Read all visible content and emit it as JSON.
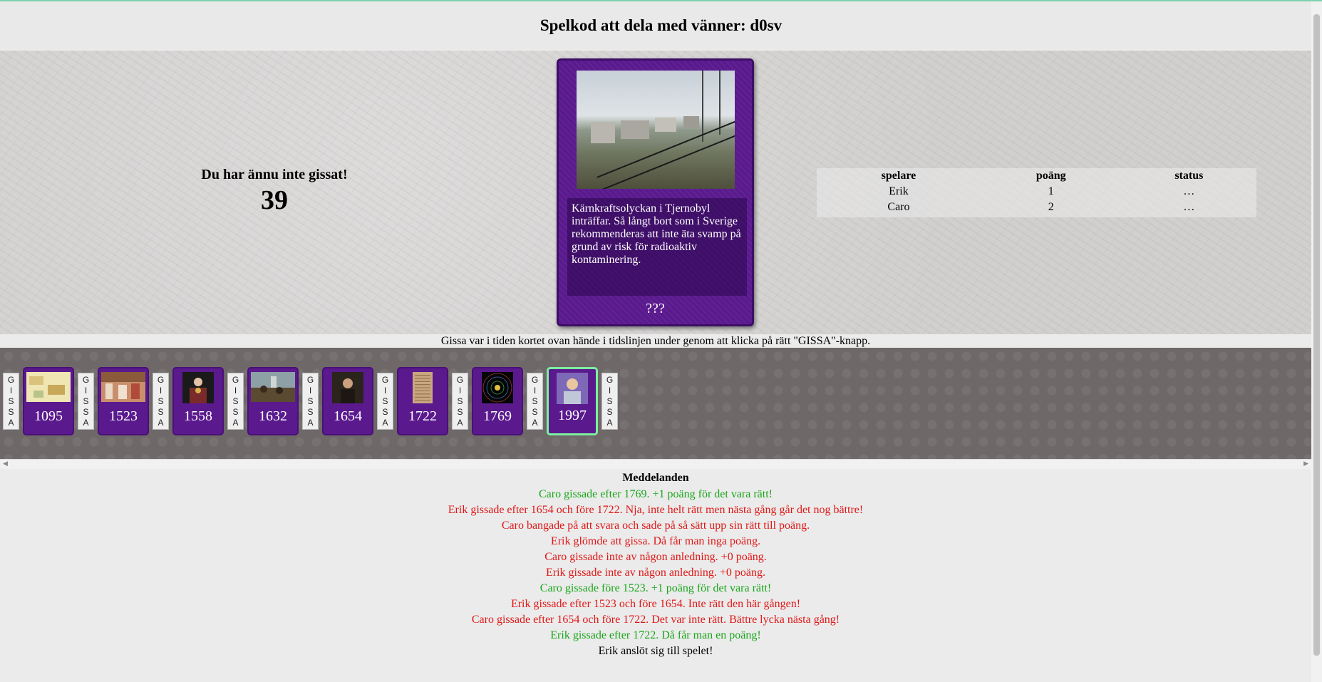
{
  "header": {
    "title": "Spelkod att dela med vänner: d0sv"
  },
  "guess_status": {
    "message": "Du har ännu inte gissat!",
    "countdown": "39"
  },
  "current_card": {
    "description": "Kärnkraftsolyckan i Tjernobyl inträffar. Så långt bort som i Sverige rekommenderas att inte äta svamp på grund av risk för radioaktiv kontaminering.",
    "year": "???"
  },
  "scoreboard": {
    "headers": [
      "spelare",
      "poäng",
      "status"
    ],
    "rows": [
      {
        "player": "Erik",
        "points": "1",
        "status": "…"
      },
      {
        "player": "Caro",
        "points": "2",
        "status": "…"
      }
    ]
  },
  "instruction": "Gissa var i tiden kortet ovan hände i tidslinjen under genom att klicka på rätt \"GISSA\"-knapp.",
  "guess_button_letters": [
    "G",
    "I",
    "S",
    "S",
    "A"
  ],
  "timeline": [
    {
      "year": "1095",
      "thumb": "map"
    },
    {
      "year": "1523",
      "thumb": "painting-crowd"
    },
    {
      "year": "1558",
      "thumb": "portrait-queen"
    },
    {
      "year": "1632",
      "thumb": "battle-painting"
    },
    {
      "year": "1654",
      "thumb": "portrait-man"
    },
    {
      "year": "1722",
      "thumb": "document"
    },
    {
      "year": "1769",
      "thumb": "solar-system"
    },
    {
      "year": "1997",
      "thumb": "portrait-woman",
      "current": true
    }
  ],
  "messages": {
    "title": "Meddelanden",
    "items": [
      {
        "text": "Caro gissade efter 1769. +1 poäng för det vara rätt!",
        "color": "green"
      },
      {
        "text": "Erik gissade efter 1654 och före 1722. Nja, inte helt rätt men nästa gång går det nog bättre!",
        "color": "red"
      },
      {
        "text": "Caro bangade på att svara och sade på så sätt upp sin rätt till poäng.",
        "color": "red"
      },
      {
        "text": "Erik glömde att gissa. Då får man inga poäng.",
        "color": "red"
      },
      {
        "text": "Caro gissade inte av någon anledning. +0 poäng.",
        "color": "red"
      },
      {
        "text": "Erik gissade inte av någon anledning. +0 poäng.",
        "color": "red"
      },
      {
        "text": "Caro gissade före 1523. +1 poäng för det vara rätt!",
        "color": "green"
      },
      {
        "text": "Erik gissade efter 1523 och före 1654. Inte rätt den här gången!",
        "color": "red"
      },
      {
        "text": "Caro gissade efter 1654 och före 1722. Det var inte rätt. Bättre lycka nästa gång!",
        "color": "red"
      },
      {
        "text": "Erik gissade efter 1722. Då får man en poäng!",
        "color": "green"
      },
      {
        "text": "Erik anslöt sig till spelet!",
        "color": "black"
      }
    ]
  },
  "colors": {
    "card": "#5a1a8e",
    "highlight": "#7cf0a0",
    "positive": "#19a619",
    "negative": "#e01717"
  }
}
